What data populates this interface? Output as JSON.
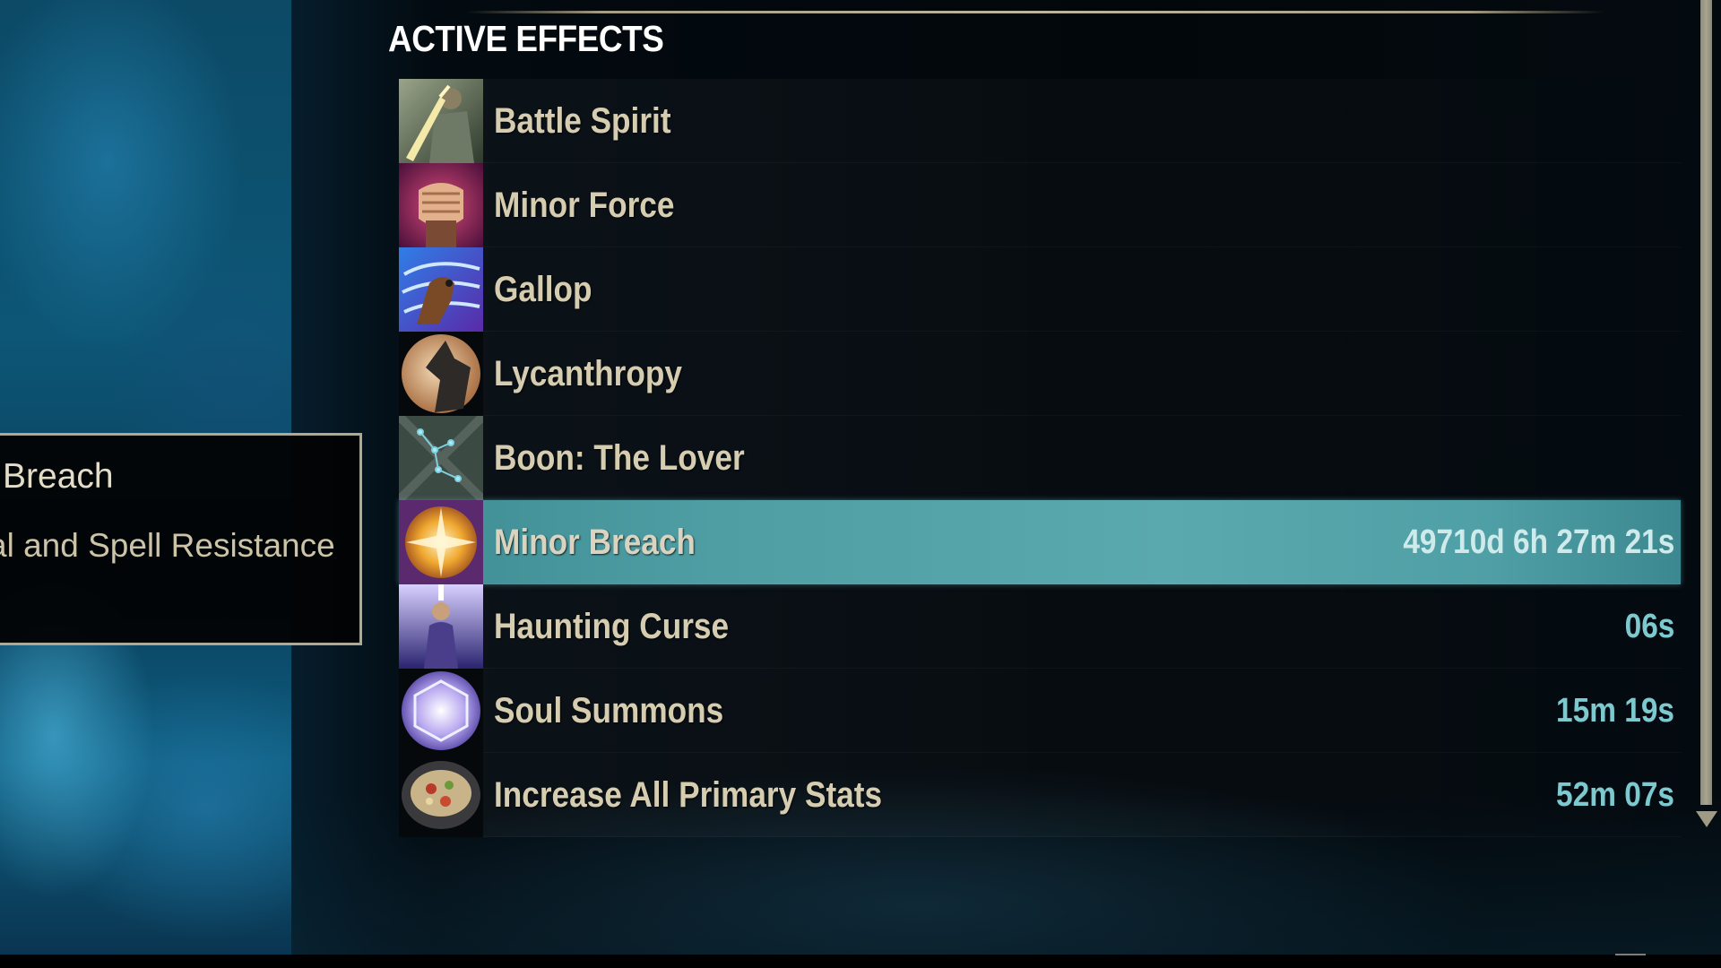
{
  "panel": {
    "title": "ACTIVE EFFECTS"
  },
  "effects": [
    {
      "name": "Battle Spirit",
      "time": "",
      "icon": "battle-spirit-icon"
    },
    {
      "name": "Minor Force",
      "time": "",
      "icon": "minor-force-icon"
    },
    {
      "name": "Gallop",
      "time": "",
      "icon": "gallop-icon"
    },
    {
      "name": "Lycanthropy",
      "time": "",
      "icon": "lycanthropy-icon"
    },
    {
      "name": "Boon: The Lover",
      "time": "",
      "icon": "boon-lover-icon"
    },
    {
      "name": "Minor Breach",
      "time": "49710d 6h 27m 21s",
      "icon": "minor-breach-icon",
      "selected": true
    },
    {
      "name": "Haunting Curse",
      "time": "06s",
      "icon": "haunting-curse-icon"
    },
    {
      "name": "Soul Summons",
      "time": "15m 19s",
      "icon": "soul-summons-icon"
    },
    {
      "name": "Increase All Primary Stats",
      "time": "52m 07s",
      "icon": "food-buff-icon"
    }
  ],
  "tooltip": {
    "title": "Breach",
    "description": "al and Spell Resistance"
  },
  "colors": {
    "selected_row": "#4e9ea4",
    "effect_name": "#d6cdb0",
    "effect_time": "#7cc9d0",
    "title": "#ffffff",
    "tooltip_border": "#b0a98d"
  }
}
